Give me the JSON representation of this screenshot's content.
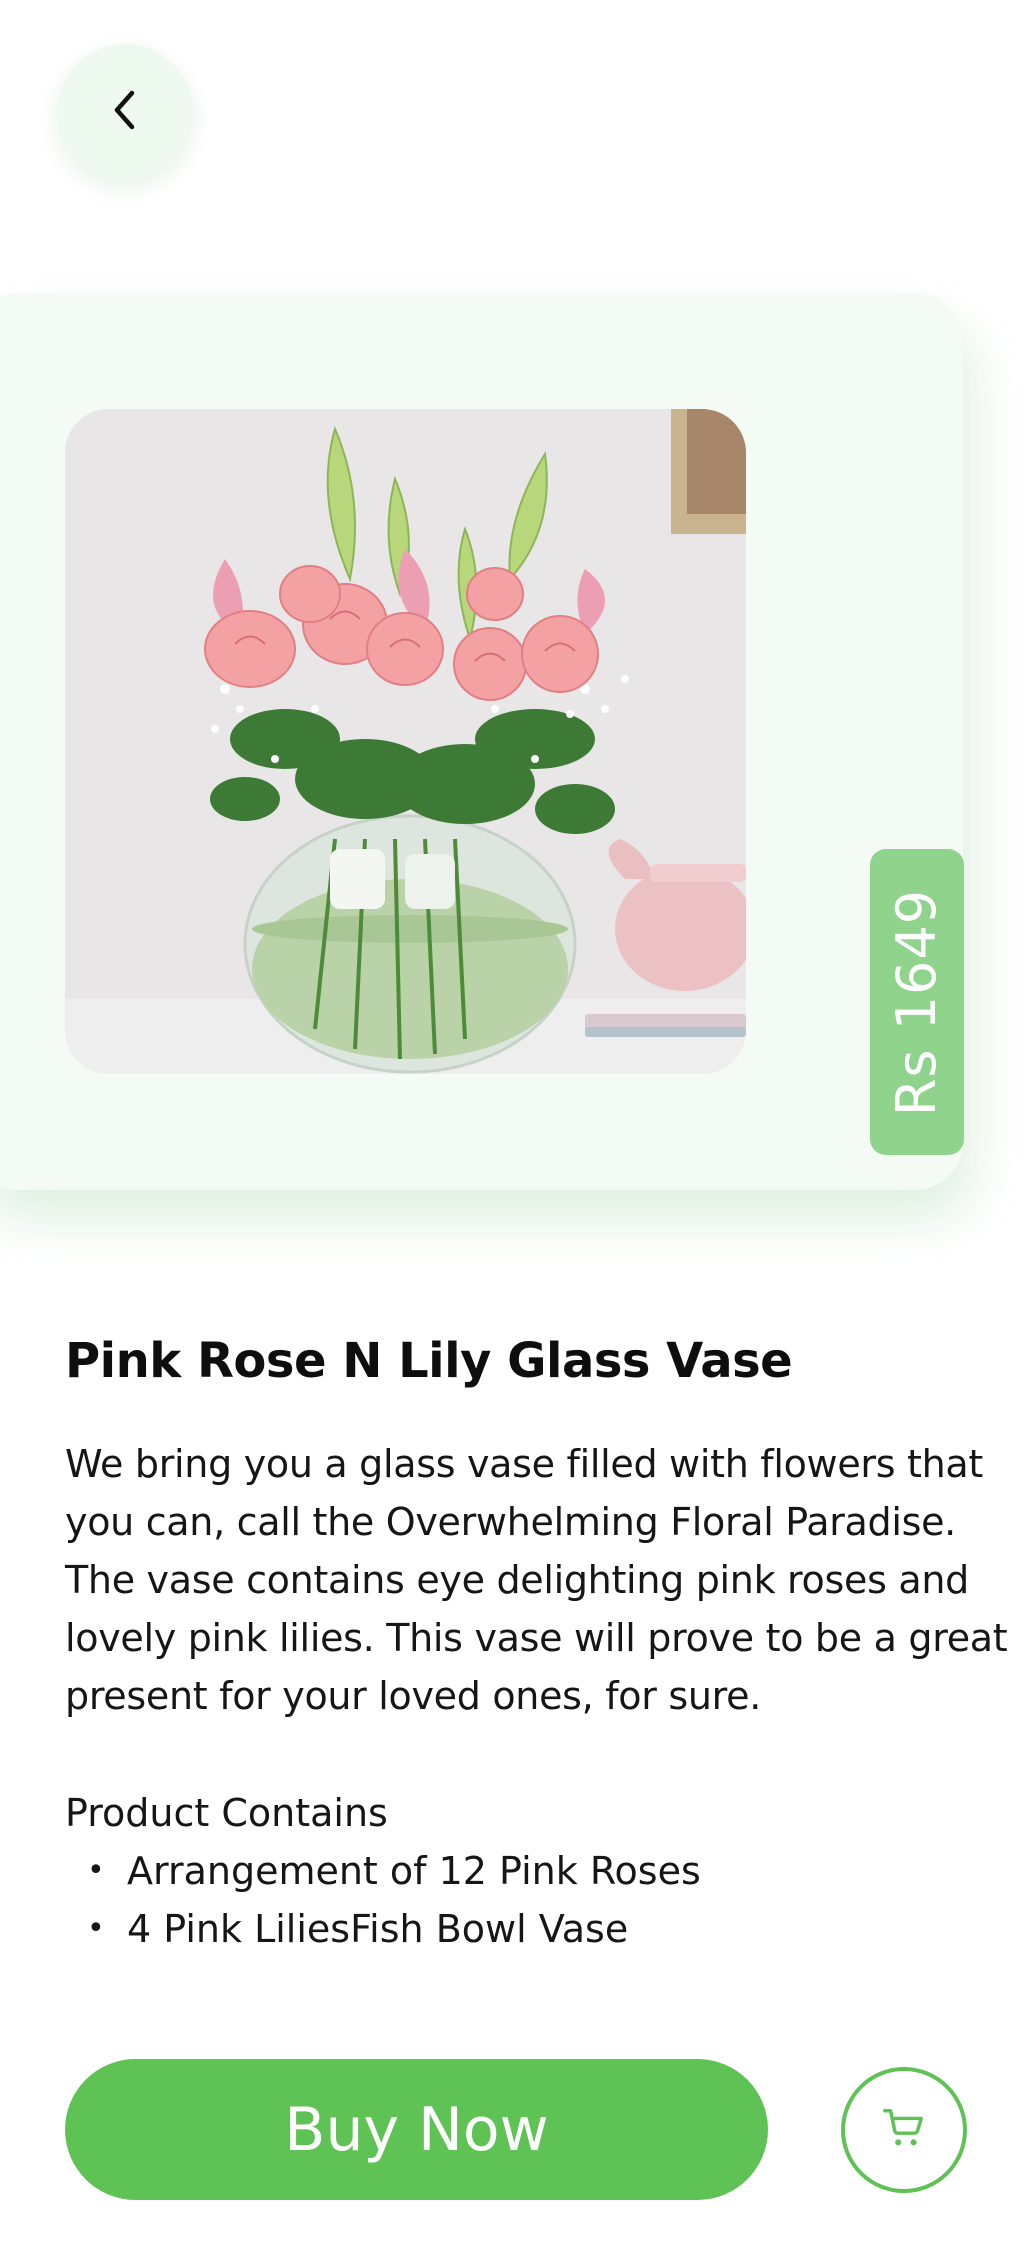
{
  "header": {
    "back_icon": "chevron-left-icon"
  },
  "product": {
    "image_alt": "Pink roses and pink lilies arranged in a round glass fish bowl vase",
    "price": "Rs 1649",
    "title": "Pink Rose N Lily Glass Vase",
    "description": "We bring you a glass vase filled with flowers that you can, call the Overwhelming Floral Paradise. The vase contains eye delighting pink roses and lovely pink lilies. This vase will prove to be a great present for your loved ones, for sure.",
    "contains_heading": "Product Contains",
    "contains_items": [
      "Arrangement of 12 Pink Roses",
      "4 Pink LiliesFish Bowl Vase"
    ]
  },
  "actions": {
    "buy_label": "Buy Now",
    "cart_icon": "shopping-cart-icon"
  },
  "colors": {
    "accent": "#5fc255",
    "price_tab": "#8fd38c",
    "card_bg": "#f3fbf4",
    "back_btn_bg": "#eefaf0"
  }
}
